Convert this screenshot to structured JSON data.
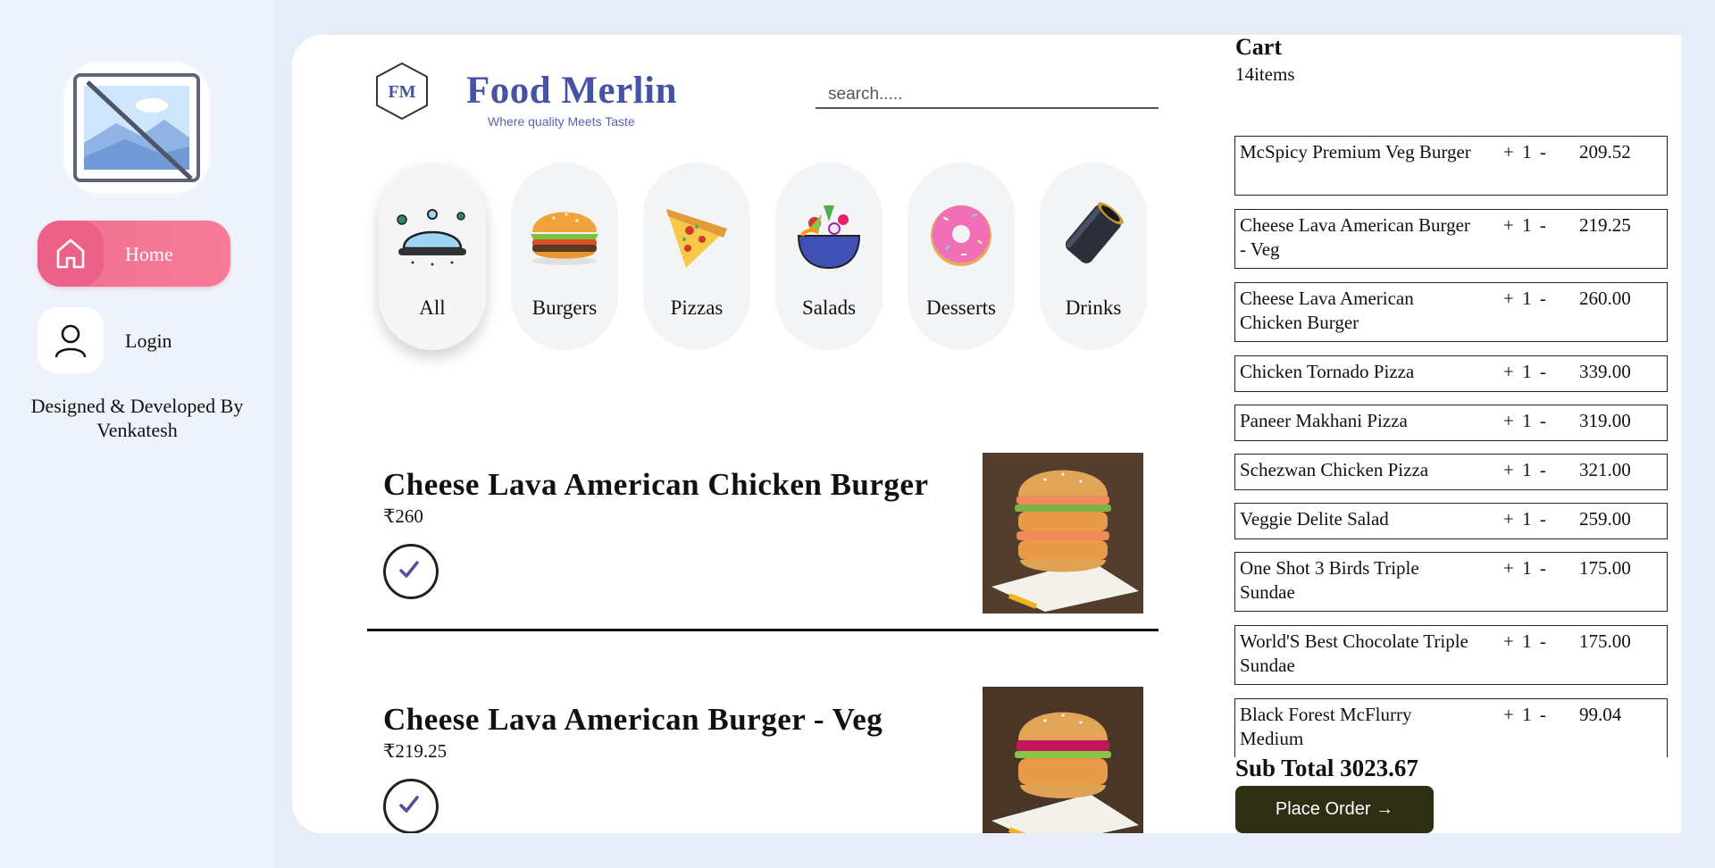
{
  "sidebar": {
    "nav": [
      {
        "label": "Home",
        "icon": "home-icon",
        "active": true
      },
      {
        "label": "Login",
        "icon": "user-icon",
        "active": false
      }
    ],
    "credit_line1": "Designed & Developed By",
    "credit_line2": "Venkatesh"
  },
  "header": {
    "logo_mark": "FM",
    "brand": "Food Merlin",
    "tagline": "Where quality Meets Taste",
    "search_placeholder": "search....."
  },
  "categories": [
    {
      "label": "All",
      "icon": "cloche-icon",
      "active": true
    },
    {
      "label": "Burgers",
      "icon": "burger-icon",
      "active": false
    },
    {
      "label": "Pizzas",
      "icon": "pizza-icon",
      "active": false
    },
    {
      "label": "Salads",
      "icon": "salad-icon",
      "active": false
    },
    {
      "label": "Desserts",
      "icon": "donut-icon",
      "active": false
    },
    {
      "label": "Drinks",
      "icon": "can-icon",
      "active": false
    }
  ],
  "items": [
    {
      "title": "Cheese Lava American Chicken Burger",
      "price": "₹260",
      "in_cart": true
    },
    {
      "title": "Cheese Lava American Burger - Veg",
      "price": "₹219.25",
      "in_cart": true
    }
  ],
  "cart": {
    "title": "Cart",
    "count": "14items",
    "items": [
      {
        "name": "McSpicy Premium Veg Burger",
        "qty": "+ 1 -",
        "price": "209.52"
      },
      {
        "name": "Cheese Lava American Burger - Veg",
        "qty": "+ 1 -",
        "price": "219.25"
      },
      {
        "name": "Cheese Lava American Chicken Burger",
        "qty": "+ 1 -",
        "price": "260.00"
      },
      {
        "name": "Chicken Tornado Pizza",
        "qty": "+ 1 -",
        "price": "339.00"
      },
      {
        "name": "Paneer Makhani Pizza",
        "qty": "+ 1 -",
        "price": "319.00"
      },
      {
        "name": "Schezwan Chicken Pizza",
        "qty": "+ 1 -",
        "price": "321.00"
      },
      {
        "name": "Veggie Delite Salad",
        "qty": "+ 1 -",
        "price": "259.00"
      },
      {
        "name": "One Shot 3 Birds Triple Sundae",
        "qty": "+ 1 -",
        "price": "175.00"
      },
      {
        "name": "World'S Best Chocolate Triple Sundae",
        "qty": "+ 1 -",
        "price": "175.00"
      },
      {
        "name": "Black Forest McFlurry Medium",
        "qty": "+ 1 -",
        "price": "99.04"
      }
    ],
    "subtotal": "Sub Total 3023.67",
    "place_order": "Place Order →"
  },
  "colors": {
    "accent_pink": "#f77b98",
    "brand_blue": "#4652a6",
    "order_button": "#2e2e14"
  }
}
